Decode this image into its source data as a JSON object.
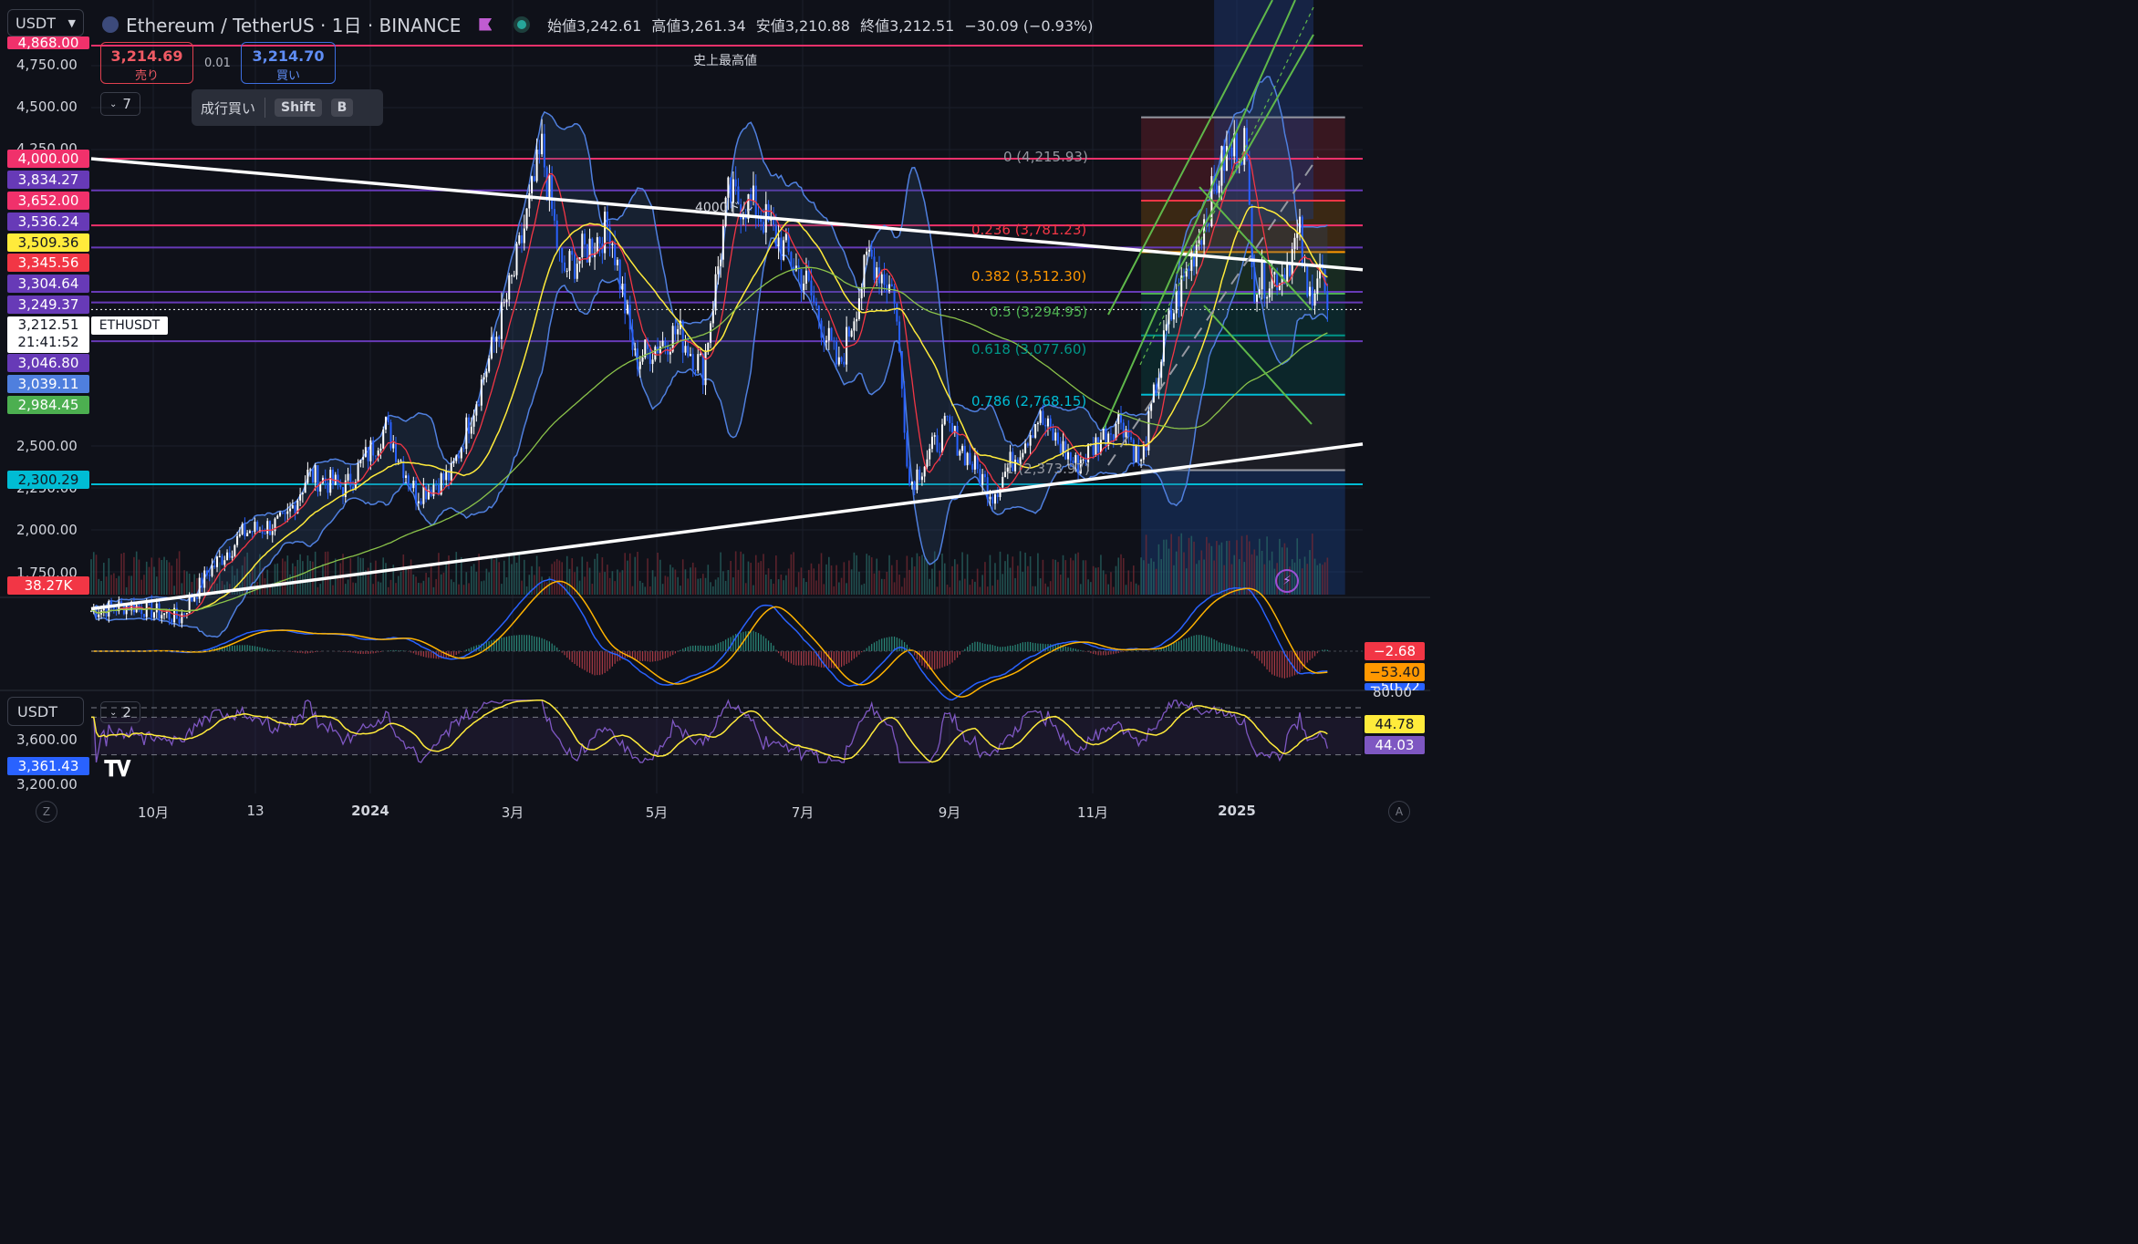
{
  "header": {
    "currency": "USDT",
    "title": "Ethereum / TetherUS · 1日 · BINANCE",
    "ohlc": [
      {
        "k": "始値",
        "v": "3,242.61"
      },
      {
        "k": "高値",
        "v": "3,261.34"
      },
      {
        "k": "安値",
        "v": "3,210.88"
      },
      {
        "k": "終値",
        "v": "3,212.51"
      },
      {
        "k": "",
        "v": "−30.09 (−0.93%)"
      }
    ]
  },
  "trade": {
    "sell_price": "3,214.69",
    "sell_label": "売り",
    "spread": "0.01",
    "buy_price": "3,214.70",
    "buy_label": "買い",
    "qty": "7",
    "tooltip_label": "成行買い",
    "tooltip_key1": "Shift",
    "tooltip_key2": "B"
  },
  "annotations": {
    "ath": "史上最高値",
    "level4000": "4000ドル",
    "symbol_tag": "ETHUSDT",
    "countdown": "21:41:52"
  },
  "colors": {
    "background": "#0f1119",
    "up_candle": "#ffffff",
    "down_candle": "#2962ff",
    "ema_red": "#f23645",
    "ema_yellow": "#ffeb3b",
    "sma_green": "#8bc34a",
    "bollinger": "#4f7fde",
    "hline_pink": "#f0316b",
    "hline_purple": "#673ab7",
    "hline_cyan": "#00bcd4",
    "trendline": "#ffffff",
    "channel": "#5fb84a",
    "fib_red": "#f23645",
    "fib_orange": "#ff9800",
    "fib_grey": "#9598a1",
    "fib_green": "#4caf50",
    "fib_teal": "#009688",
    "fib_cyan": "#00bcd4"
  },
  "left_labels": [
    {
      "text": "4,868.00",
      "color": "#f0316b",
      "clipped": true
    },
    {
      "text": "4,000.00",
      "color": "#f0316b"
    },
    {
      "text": "3,834.27",
      "color": "#673ab7"
    },
    {
      "text": "3,652.00",
      "color": "#f0316b"
    },
    {
      "text": "3,536.24",
      "color": "#673ab7"
    },
    {
      "text": "3,509.36",
      "color": "#ffeb3b"
    },
    {
      "text": "3,345.56",
      "color": "#f23645"
    },
    {
      "text": "3,304.64",
      "color": "#673ab7"
    },
    {
      "text": "3,249.37",
      "color": "#673ab7"
    },
    {
      "text": "3,212.51",
      "color": "#ffffff"
    },
    {
      "text": "3,046.80",
      "color": "#673ab7"
    },
    {
      "text": "3,039.11",
      "color": "#4f7fde"
    },
    {
      "text": "2,984.45",
      "color": "#4caf50"
    },
    {
      "text": "2,300.29",
      "color": "#00bcd4"
    },
    {
      "text": "38.27K",
      "color": "#f23645"
    }
  ],
  "price_ticks": [
    "4,750.00",
    "4,500.00",
    "4,250.00",
    "2,500.00",
    "2,250.00",
    "2,000.00",
    "1,750.00"
  ],
  "fib_levels": [
    {
      "label": "0 (4,215.93)",
      "color": "#9598a1"
    },
    {
      "label": "0.236 (3,781.23)",
      "color": "#f23645"
    },
    {
      "label": "0.382 (3,512.30)",
      "color": "#ff9800"
    },
    {
      "label": "0.5 (3,294.95)",
      "color": "#4caf50"
    },
    {
      "label": "0.618 (3,077.60)",
      "color": "#009688"
    },
    {
      "label": "0.786 (2,768.15)",
      "color": "#00bcd4"
    },
    {
      "label": "1 (2,373.97)",
      "color": "#9598a1"
    }
  ],
  "macd": {
    "labels": [
      {
        "text": "−2.68",
        "color": "#f23645"
      },
      {
        "text": "−53.40",
        "color": "#ff9800"
      },
      {
        "text": "−50.72",
        "color": "#2962ff",
        "clipped": true
      }
    ]
  },
  "rsi": {
    "currency": "USDT",
    "qty": "2",
    "top_tick": "80.00",
    "right_labels": [
      {
        "text": "44.78",
        "color": "#ffeb3b"
      },
      {
        "text": "44.03",
        "color": "#7e57c2"
      }
    ],
    "left_ticks": [
      "3,600.00",
      "3,200.00"
    ],
    "left_label": "3,361.43"
  },
  "x_axis": [
    "10月",
    "13",
    "2024",
    "3月",
    "5月",
    "7月",
    "9月",
    "11月",
    "2025"
  ],
  "footer": {
    "left_btn": "Z",
    "right_btn": "A"
  },
  "chart_data": {
    "type": "candlestick",
    "symbol": "ETHUSDT",
    "interval": "1D",
    "exchange": "BINANCE",
    "ylim": [
      1650,
      4900
    ],
    "close_series": [
      {
        "date": "2023-09-15",
        "close": 1640
      },
      {
        "date": "2023-10-01",
        "close": 1670
      },
      {
        "date": "2023-10-20",
        "close": 1600
      },
      {
        "date": "2023-11-01",
        "close": 1850
      },
      {
        "date": "2023-11-15",
        "close": 2050
      },
      {
        "date": "2023-12-01",
        "close": 2100
      },
      {
        "date": "2023-12-10",
        "close": 2350
      },
      {
        "date": "2023-12-25",
        "close": 2280
      },
      {
        "date": "2024-01-10",
        "close": 2600
      },
      {
        "date": "2024-01-22",
        "close": 2250
      },
      {
        "date": "2024-02-05",
        "close": 2350
      },
      {
        "date": "2024-02-20",
        "close": 2950
      },
      {
        "date": "2024-03-01",
        "close": 3400
      },
      {
        "date": "2024-03-12",
        "close": 4050
      },
      {
        "date": "2024-03-20",
        "close": 3400
      },
      {
        "date": "2024-04-08",
        "close": 3650
      },
      {
        "date": "2024-04-18",
        "close": 2950
      },
      {
        "date": "2024-05-05",
        "close": 3100
      },
      {
        "date": "2024-05-15",
        "close": 2900
      },
      {
        "date": "2024-05-25",
        "close": 3800
      },
      {
        "date": "2024-06-05",
        "close": 3750
      },
      {
        "date": "2024-06-25",
        "close": 3350
      },
      {
        "date": "2024-07-08",
        "close": 2900
      },
      {
        "date": "2024-07-20",
        "close": 3500
      },
      {
        "date": "2024-07-30",
        "close": 3300
      },
      {
        "date": "2024-08-05",
        "close": 2300
      },
      {
        "date": "2024-08-20",
        "close": 2600
      },
      {
        "date": "2024-09-07",
        "close": 2250
      },
      {
        "date": "2024-09-25",
        "close": 2650
      },
      {
        "date": "2024-10-10",
        "close": 2400
      },
      {
        "date": "2024-10-28",
        "close": 2650
      },
      {
        "date": "2024-11-05",
        "close": 2400
      },
      {
        "date": "2024-11-15",
        "close": 3100
      },
      {
        "date": "2024-11-28",
        "close": 3600
      },
      {
        "date": "2024-12-08",
        "close": 4000
      },
      {
        "date": "2024-12-16",
        "close": 4100
      },
      {
        "date": "2024-12-20",
        "close": 3350
      },
      {
        "date": "2024-12-31",
        "close": 3400
      },
      {
        "date": "2025-01-07",
        "close": 3600
      },
      {
        "date": "2025-01-10",
        "close": 3250
      },
      {
        "date": "2025-01-15",
        "close": 3450
      },
      {
        "date": "2025-01-18",
        "close": 3212.51
      }
    ],
    "horizontal_levels": [
      4868,
      4000,
      3834.27,
      3652,
      3536.24,
      3304.64,
      3249.37,
      3046.8,
      2300.29
    ],
    "trendlines": [
      {
        "from": {
          "date": "2023-09-15",
          "price": 4000
        },
        "to": {
          "date": "2025-02-01",
          "price": 3420
        }
      },
      {
        "from": {
          "date": "2023-09-15",
          "price": 1650
        },
        "to": {
          "date": "2025-02-01",
          "price": 2510
        }
      }
    ]
  }
}
